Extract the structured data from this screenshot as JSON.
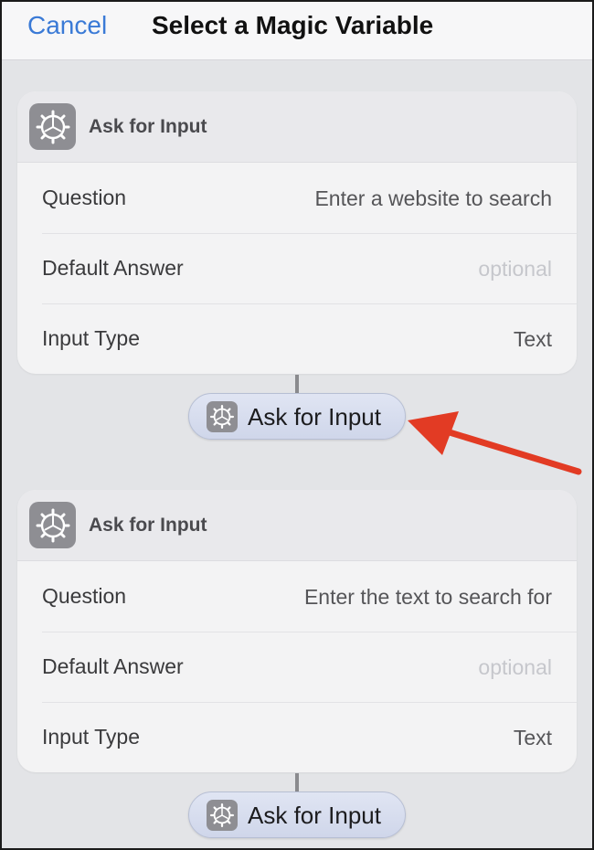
{
  "nav": {
    "cancel_label": "Cancel",
    "title": "Select a Magic Variable"
  },
  "cards": [
    {
      "icon": "gear-icon",
      "title": "Ask for Input",
      "rows": [
        {
          "label": "Question",
          "value": "Enter a website to search"
        },
        {
          "label": "Default Answer",
          "value": "optional"
        },
        {
          "label": "Input Type",
          "value": "Text"
        }
      ]
    },
    {
      "icon": "gear-icon",
      "title": "Ask for Input",
      "rows": [
        {
          "label": "Question",
          "value": "Enter the text to search for"
        },
        {
          "label": "Default Answer",
          "value": "optional"
        },
        {
          "label": "Input Type",
          "value": "Text"
        }
      ]
    }
  ],
  "variables": [
    {
      "icon": "gear-icon",
      "label": "Ask for Input"
    },
    {
      "icon": "gear-icon",
      "label": "Ask for Input"
    }
  ],
  "colors": {
    "accent": "#3a7ad6",
    "arrow": "#e23b24",
    "pill": "#d6dcee"
  }
}
